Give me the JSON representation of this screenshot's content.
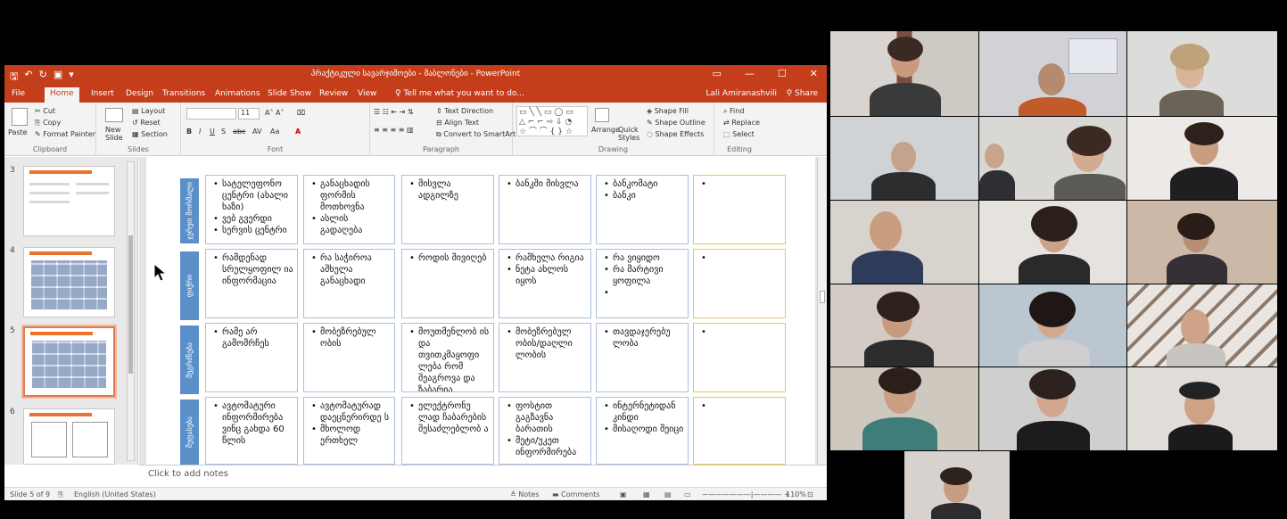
{
  "app": {
    "title": "პრაქტიკული სავარჯიშოები - შაბლონები - PowerPoint",
    "user": "Lali Amiranashvili",
    "share": "Share",
    "qat_icons": [
      "save-icon",
      "undo-icon",
      "redo-icon",
      "start-from-beginning-icon",
      "customize-icon"
    ]
  },
  "tabs": [
    "File",
    "Home",
    "Insert",
    "Design",
    "Transitions",
    "Animations",
    "Slide Show",
    "Review",
    "View"
  ],
  "tell_me": "Tell me what you want to do...",
  "active_tab": "Home",
  "ribbon": {
    "clipboard": {
      "label": "Clipboard",
      "paste": "Paste",
      "cut": "Cut",
      "copy": "Copy",
      "format_painter": "Format Painter"
    },
    "slides": {
      "label": "Slides",
      "new_slide": "New Slide",
      "layout": "Layout",
      "reset": "Reset",
      "section": "Section"
    },
    "font": {
      "label": "Font",
      "size": "11",
      "bold": "B",
      "italic": "I",
      "underline": "U",
      "strike": "S",
      "abc": "abc"
    },
    "paragraph": {
      "label": "Paragraph",
      "text_direction": "Text Direction",
      "align_text": "Align Text",
      "convert": "Convert to SmartArt"
    },
    "drawing": {
      "label": "Drawing",
      "arrange": "Arrange",
      "quick_styles": "Quick Styles",
      "shape_fill": "Shape Fill",
      "shape_outline": "Shape Outline",
      "shape_effects": "Shape Effects"
    },
    "editing": {
      "label": "Editing",
      "find": "Find",
      "replace": "Replace",
      "select": "Select"
    }
  },
  "thumbnails": [
    {
      "number": "3",
      "selected": false
    },
    {
      "number": "4",
      "selected": false
    },
    {
      "number": "5",
      "selected": true
    },
    {
      "number": "6",
      "selected": false
    }
  ],
  "slide_rows": [
    {
      "label": "ჯერეთ მორმალი",
      "cells": [
        [
          "სატელეფონო ცენტრი (ახალი ხაზი)",
          "ვებ გვერდი",
          "სერვის ცენტრი"
        ],
        [
          "განაცხადის ფორმის მოთხოვნა",
          "ასლის გადაღება"
        ],
        [
          "მისვლა ადგილზე"
        ],
        [
          "ბანკში მისვლა"
        ],
        [
          "ბანკომატი",
          "ბანკი"
        ],
        [
          ""
        ]
      ]
    },
    {
      "label": "ფიქრი",
      "cells": [
        [
          "რამდენად სრულყოფილ ია ინფორმაცია"
        ],
        [
          "რა საჭიროა აშხულა განაცხადი"
        ],
        [
          "როდის მივიღებ"
        ],
        [
          "რამხელა რიგია",
          "ნეტა ახლოს იყოს"
        ],
        [
          "რა ვიყიდო",
          "რა მარტივი ყოფილა",
          ""
        ],
        [
          ""
        ]
      ]
    },
    {
      "label": "შეგრძნება",
      "cells": [
        [
          "რამე არ გამომრჩეს"
        ],
        [
          "მობეზრებულ ობის"
        ],
        [
          "მოუთმენლობ ის და თვითკმაყოფი ლება რომ შეაგროვა და ზაბარია"
        ],
        [
          "მობეზრებულ ობის/დაღლი ლობის"
        ],
        [
          "თავდაჯერებუ ლობა"
        ],
        [
          ""
        ]
      ]
    },
    {
      "label": "შეფასება",
      "cells": [
        [
          "ავტომატური ინფორმირება ვინც გახდა 60 წლის"
        ],
        [
          "ავტომატურად დაეცნერირდე ს",
          "მხოლოდ ერთხელ"
        ],
        [
          "ელექტრონუ ლად ჩაბარების შესაძლებლობ ა"
        ],
        [
          "ფოსტით გაგზავნა ბარათის",
          "მეტი/უკეთ ინფორმირება"
        ],
        [
          "ინტერნეტიდან კინდი",
          "მისაღოდი მეიცი"
        ],
        [
          ""
        ]
      ]
    }
  ],
  "notes_placeholder": "Click to add notes",
  "status": {
    "slide_of": "Slide 5 of 9",
    "language": "English (United States)",
    "notes": "Notes",
    "comments": "Comments",
    "zoom": "110%"
  },
  "colors": {
    "ppt_accent": "#c43e1c",
    "row_label_blue": "#5b8fc9",
    "cell_border": "#aac0dc",
    "gold_border": "#e8c55a"
  }
}
